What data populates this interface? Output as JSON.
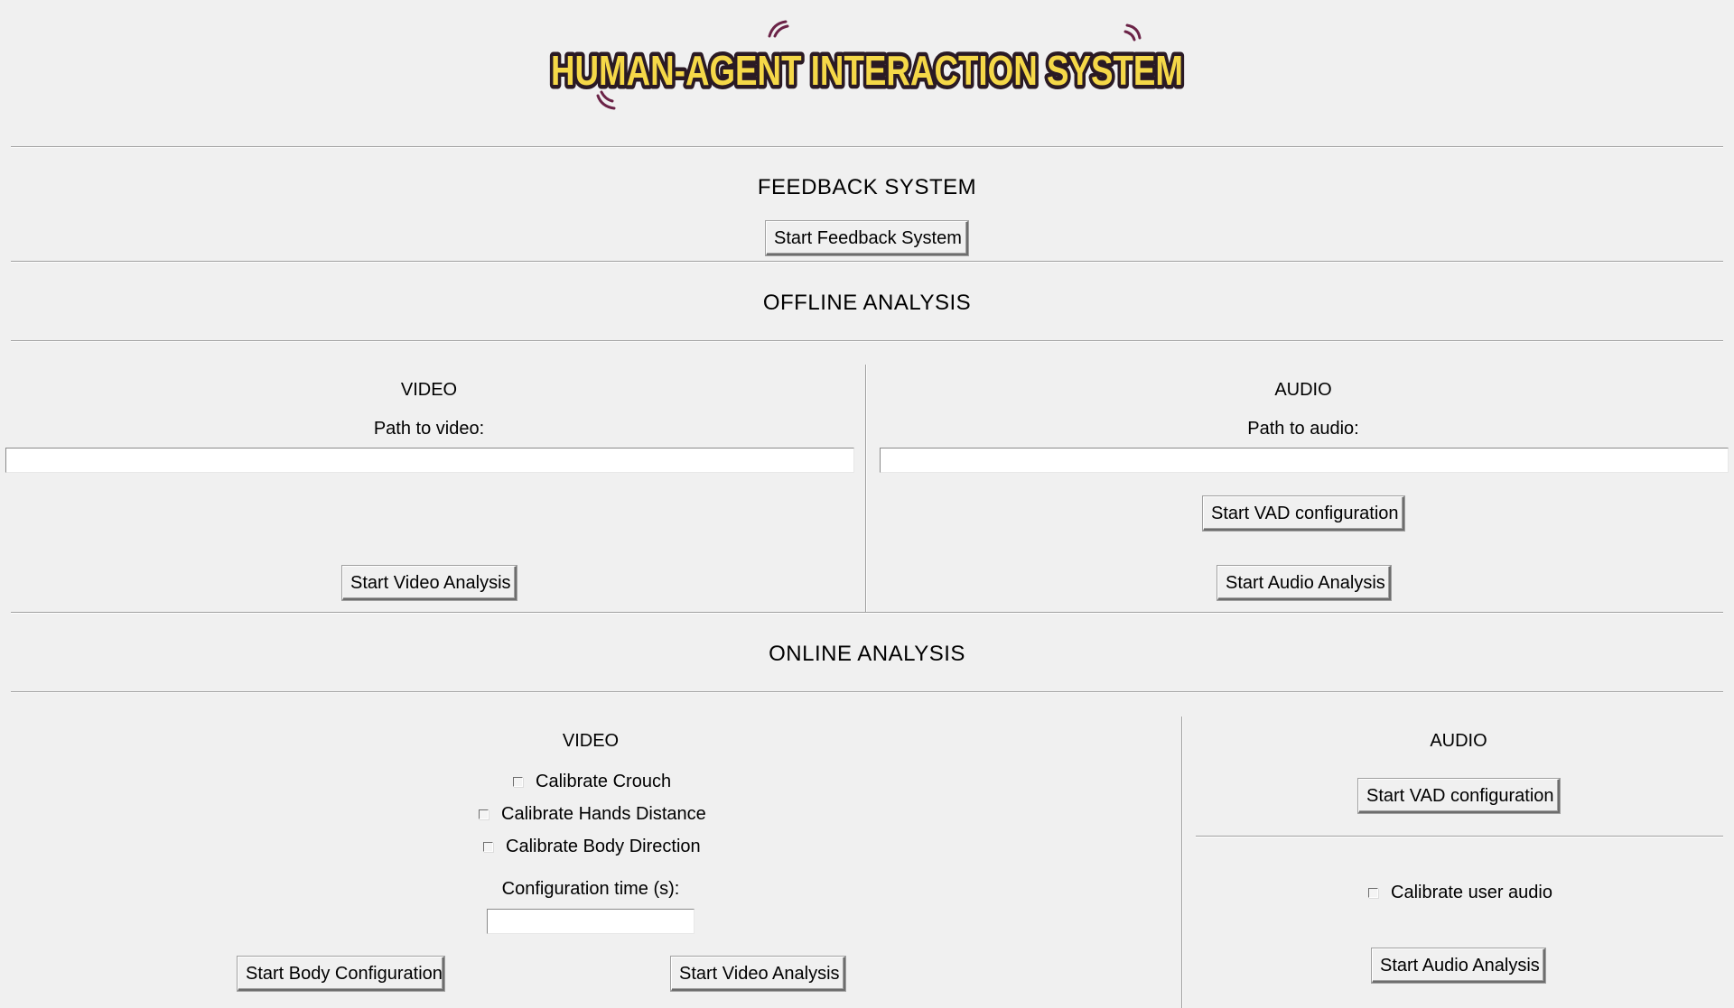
{
  "app": {
    "title": "HUMAN-AGENT INTERACTION SYSTEM",
    "colors": {
      "background": "#f0f0f0",
      "logo_fill": "#f5d848",
      "logo_outline": "#2a1a24",
      "logo_accent": "#6b2347"
    }
  },
  "feedback": {
    "title": "FEEDBACK SYSTEM",
    "start_button": "Start Feedback System"
  },
  "offline": {
    "title": "OFFLINE ANALYSIS",
    "video": {
      "title": "VIDEO",
      "path_label": "Path to video:",
      "path_value": "",
      "start_button": "Start Video Analysis"
    },
    "audio": {
      "title": "AUDIO",
      "path_label": "Path to audio:",
      "path_value": "",
      "vad_button": "Start VAD configuration",
      "start_button": "Start Audio Analysis"
    }
  },
  "online": {
    "title": "ONLINE ANALYSIS",
    "video": {
      "title": "VIDEO",
      "checkboxes": [
        {
          "label": "Calibrate Crouch",
          "checked": false
        },
        {
          "label": "Calibrate Hands Distance",
          "checked": false
        },
        {
          "label": "Calibrate Body Direction",
          "checked": false
        }
      ],
      "config_time_label": "Configuration time (s):",
      "config_time_value": "",
      "body_config_button": "Start Body Configuration",
      "start_button": "Start Video Analysis"
    },
    "audio": {
      "title": "AUDIO",
      "vad_button": "Start VAD configuration",
      "calibrate_user_audio": {
        "label": "Calibrate user audio",
        "checked": false
      },
      "start_button": "Start Audio Analysis"
    }
  }
}
